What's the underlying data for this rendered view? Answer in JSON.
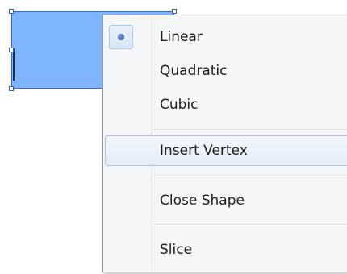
{
  "context_menu": {
    "items": [
      {
        "label": "Linear",
        "checked": true,
        "icon": "radio-bullet-icon"
      },
      {
        "label": "Quadratic",
        "checked": false
      },
      {
        "label": "Cubic",
        "checked": false
      },
      {
        "label": "Insert Vertex",
        "highlighted": true
      },
      {
        "label": "Close Shape"
      },
      {
        "label": "Slice"
      }
    ]
  },
  "colors": {
    "shape_fill": "#7fb5ff",
    "menu_background": "#f5f6f7",
    "highlight_border": "#a9c4e6"
  }
}
